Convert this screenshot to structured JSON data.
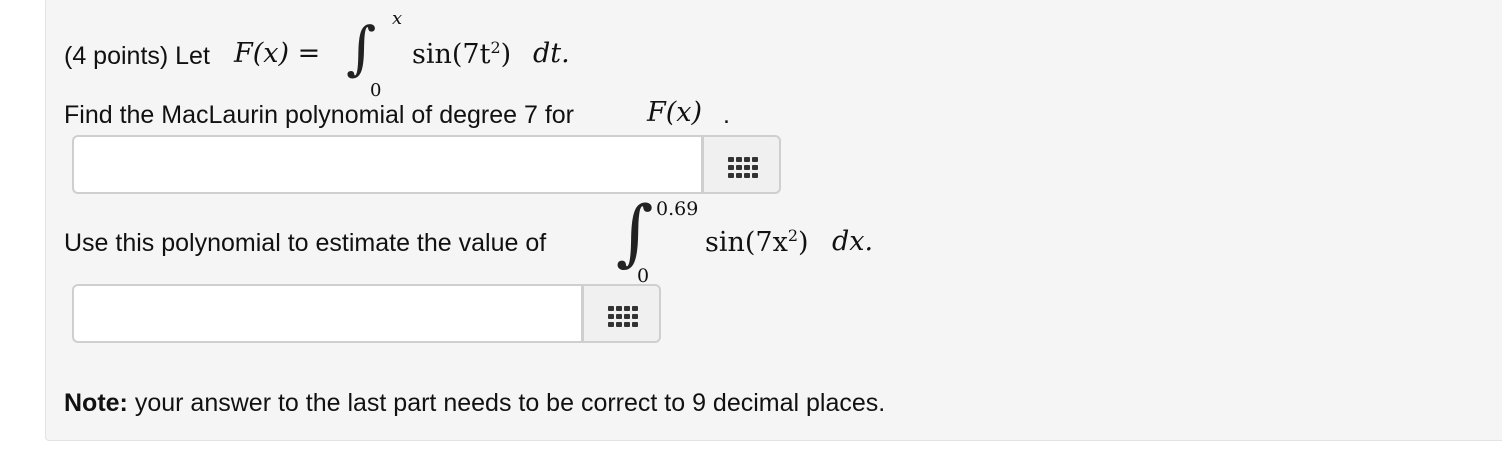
{
  "problem": {
    "points_label": "(4 points) Let",
    "definition": {
      "function_lhs": "F(x) =",
      "integral_upper": "x",
      "integral_lower": "0",
      "integrand": "sin(7t",
      "integrand_exp": "2",
      "integrand_close": ")",
      "differential": "dt."
    },
    "part1": {
      "prompt": "Find the MacLaurin polynomial of degree 7 for",
      "function_ref": "F(x)",
      "period": ".",
      "answer_value": "",
      "answer_placeholder": ""
    },
    "part2": {
      "prompt": "Use this polynomial to estimate the value of",
      "integral_upper": "0.69",
      "integral_lower": "0",
      "integrand": "sin(7x",
      "integrand_exp": "2",
      "integrand_close": ")",
      "differential": "dx.",
      "answer_value": "",
      "answer_placeholder": ""
    },
    "note": {
      "label": "Note:",
      "text": "your answer to the last part needs to be correct to 9 decimal places."
    }
  },
  "icons": {
    "palette": "grid-icon"
  },
  "colors": {
    "panel_background": "#f5f5f5",
    "panel_border": "#e3e3e3",
    "input_border": "#cfcfcf",
    "button_background": "#f0f0f0"
  }
}
